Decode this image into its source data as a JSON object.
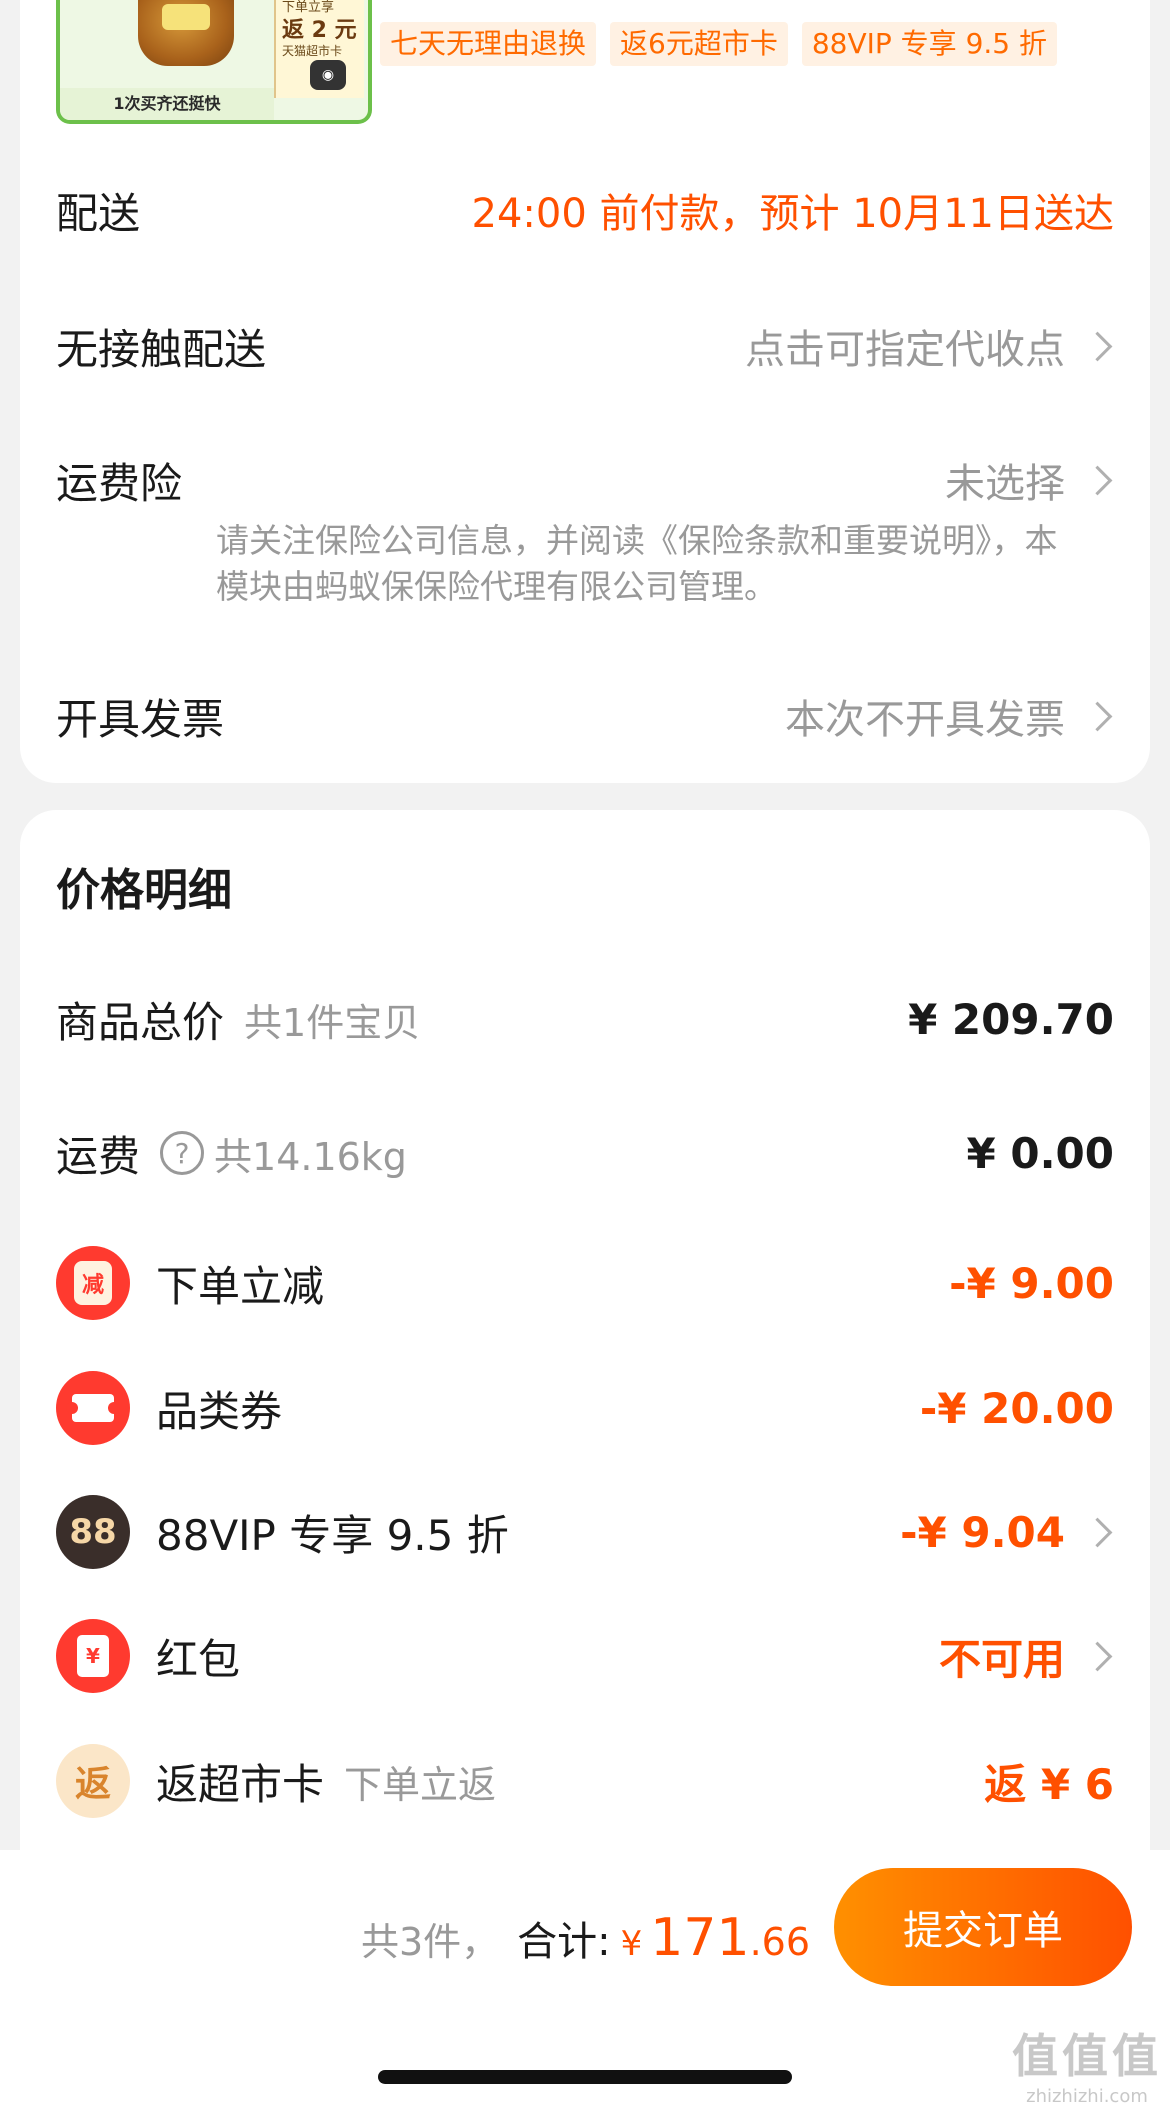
{
  "product": {
    "promo_line1": "下单立享",
    "promo_line2": "返 2 元",
    "promo_line3": "天猫超市卡",
    "footer": "1次买齐还挺快",
    "tags": [
      "七天无理由退换",
      "返6元超市卡",
      "88VIP 专享 9.5 折"
    ]
  },
  "order_options": {
    "delivery_label": "配送",
    "delivery_value": "24:00 前付款，预计 10月11日送达",
    "contactless_label": "无接触配送",
    "contactless_value": "点击可指定代收点",
    "insurance_label": "运费险",
    "insurance_value": "未选择",
    "insurance_note": "请关注保险公司信息，并阅读《保险条款和重要说明》，本模块由蚂蚁保保险代理有限公司管理。",
    "invoice_label": "开具发票",
    "invoice_value": "本次不开具发票"
  },
  "price_detail": {
    "title": "价格明细",
    "goods_total_label": "商品总价",
    "goods_total_sub": "共1件宝贝",
    "goods_total_value": "¥ 209.70",
    "shipping_label": "运费",
    "shipping_help": "?",
    "shipping_weight": "共14.16kg",
    "shipping_value": "¥ 0.00",
    "discount_icon": "减",
    "discount_label": "下单立减",
    "discount_value": "-¥ 9.00",
    "coupon_label": "品类券",
    "coupon_value": "-¥ 20.00",
    "vip_icon": "88",
    "vip_label": "88VIP 专享 9.5 折",
    "vip_value": "-¥ 9.04",
    "redpacket_icon": "¥",
    "redpacket_label": "红包",
    "redpacket_value": "不可用",
    "cashback_icon": "返",
    "cashback_label": "返超市卡",
    "cashback_sub": "下单立返",
    "cashback_value": "返 ¥ 6"
  },
  "checkout": {
    "count": "共3件，",
    "total_label": "合计:",
    "currency": "¥",
    "total_int": "171",
    "total_dec": ".66",
    "submit_label": "提交订单"
  },
  "watermark": {
    "main": "值值值",
    "url": "zhizhizhi.com"
  },
  "colors": {
    "accent": "#ff5000",
    "accent_gradient_start": "#ff9000",
    "muted": "#999999",
    "background": "#f2f2f2"
  }
}
